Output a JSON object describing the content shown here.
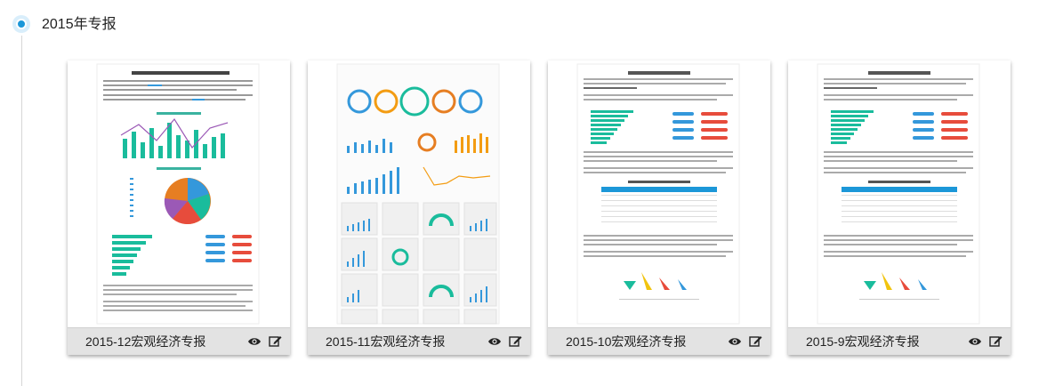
{
  "section": {
    "title": "2015年专报"
  },
  "colors": {
    "accent": "#1c97d8",
    "teal": "#1abc9c",
    "red": "#e74c3c",
    "footer_bg": "#e3e3e3"
  },
  "cards": [
    {
      "title": "2015-12宏观经济专报",
      "view_icon": "eye-icon",
      "edit_icon": "edit-icon"
    },
    {
      "title": "2015-11宏观经济专报",
      "view_icon": "eye-icon",
      "edit_icon": "edit-icon"
    },
    {
      "title": "2015-10宏观经济专报",
      "view_icon": "eye-icon",
      "edit_icon": "edit-icon"
    },
    {
      "title": "2015-9宏观经济专报",
      "view_icon": "eye-icon",
      "edit_icon": "edit-icon"
    }
  ]
}
